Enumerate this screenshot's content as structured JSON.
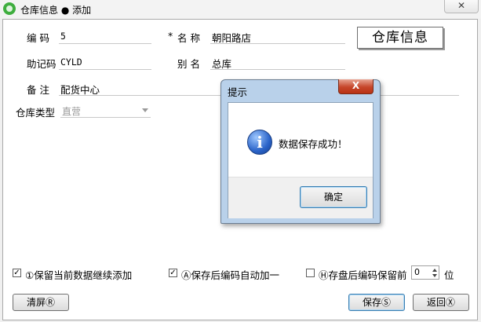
{
  "window": {
    "title": "仓库信息 ● 添加",
    "close_label": "✕"
  },
  "form": {
    "code": {
      "label": "编  码",
      "value": "5"
    },
    "name": {
      "label": "名  称",
      "required_mark": "*",
      "value": "朝阳路店"
    },
    "mnemonic": {
      "label": "助记码",
      "value": "CYLD"
    },
    "alias": {
      "label": "别  名",
      "value": "总库"
    },
    "remark": {
      "label": "备  注",
      "value": "配货中心"
    },
    "type": {
      "label": "仓库类型",
      "value": "直营"
    },
    "banner": "仓库信息"
  },
  "options": {
    "keep_data": {
      "label": "①保留当前数据继续添加",
      "checked": true
    },
    "auto_increment": {
      "label": "Ⓐ保存后编码自动加一",
      "checked": true
    },
    "keep_code": {
      "label": "Ⓗ存盘后编码保留前",
      "checked": false
    },
    "keep_digits": {
      "value": "0",
      "unit": "位"
    }
  },
  "buttons": {
    "clear": "清屏Ⓡ",
    "save": "保存Ⓢ",
    "back": "返回Ⓧ"
  },
  "dialog": {
    "title": "提示",
    "message": "数据保存成功！",
    "ok": "确定",
    "close_label": "X",
    "icon": "information-icon"
  }
}
